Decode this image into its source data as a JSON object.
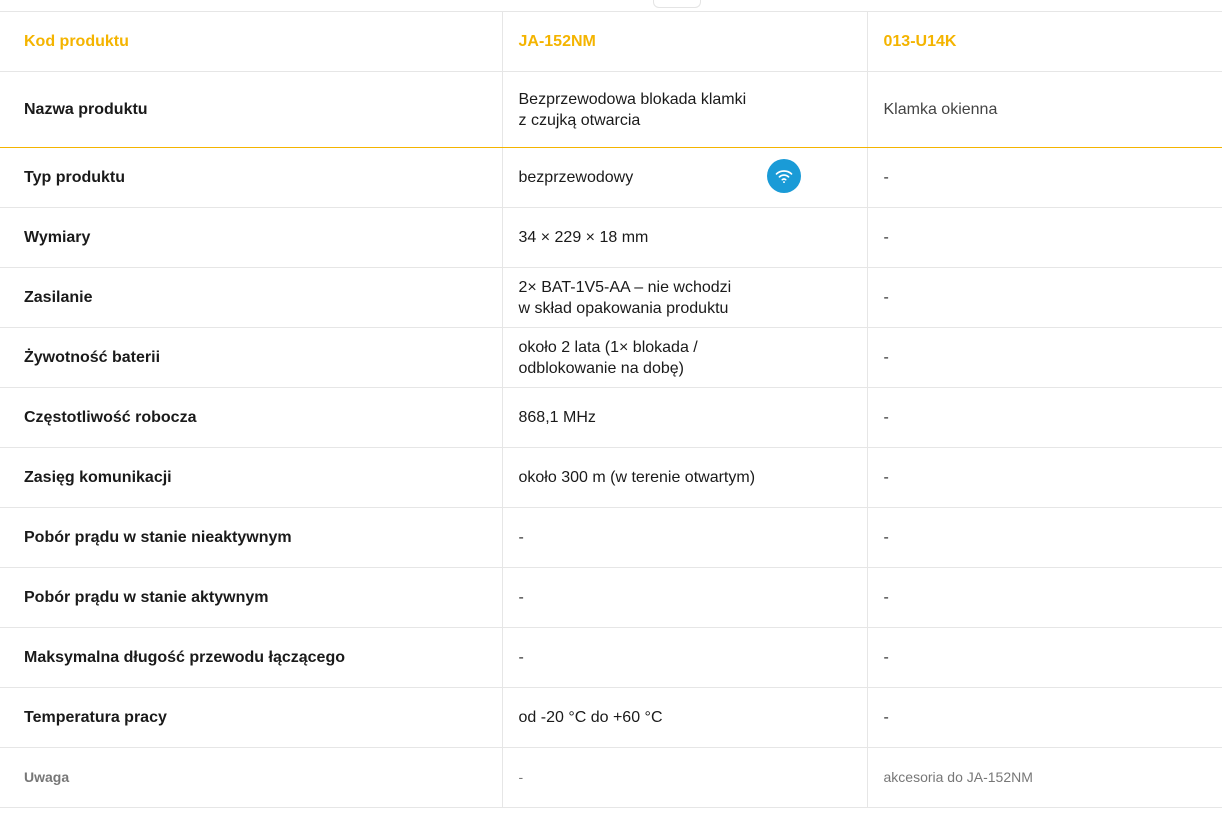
{
  "header": {
    "label": "Kod produktu",
    "col2": "JA-152NM",
    "col3": "013-U14K"
  },
  "rows": [
    {
      "label": "Nazwa produktu",
      "col2_line1": "Bezprzewodowa blokada klamki",
      "col2_line2": "z czujką otwarcia",
      "col3": "Klamka okienna"
    },
    {
      "label": "Typ produktu",
      "col2": "bezprzewodowy",
      "col2_icon": "wifi-icon",
      "col3": "-"
    },
    {
      "label": "Wymiary",
      "col2": "34 × 229 × 18 mm",
      "col3": "-"
    },
    {
      "label": "Zasilanie",
      "col2_line1": "2× BAT-1V5-AA – nie wchodzi",
      "col2_line2": "w skład opakowania produktu",
      "col3": "-"
    },
    {
      "label": "Żywotność baterii",
      "col2_line1": "około 2 lata (1× blokada /",
      "col2_line2": "odblokowanie na dobę)",
      "col3": "-"
    },
    {
      "label": "Częstotliwość robocza",
      "col2": "868,1 MHz",
      "col3": "-"
    },
    {
      "label": "Zasięg komunikacji",
      "col2": "około 300 m (w terenie otwartym)",
      "col3": "-"
    },
    {
      "label": "Pobór prądu w stanie nieaktywnym",
      "col2": "-",
      "col3": "-"
    },
    {
      "label": "Pobór prądu w stanie aktywnym",
      "col2": "-",
      "col3": "-"
    },
    {
      "label": "Maksymalna długość przewodu łączącego",
      "col2": "-",
      "col3": "-"
    },
    {
      "label": "Temperatura pracy",
      "col2": "od -20 °C do +60 °C",
      "col3": "-"
    },
    {
      "label": "Uwaga",
      "col2": "-",
      "col3": "akcesoria do JA-152NM"
    }
  ],
  "colors": {
    "accent": "#f4b400",
    "wifi_badge": "#1a9bd7",
    "border": "#e6e6e6"
  }
}
